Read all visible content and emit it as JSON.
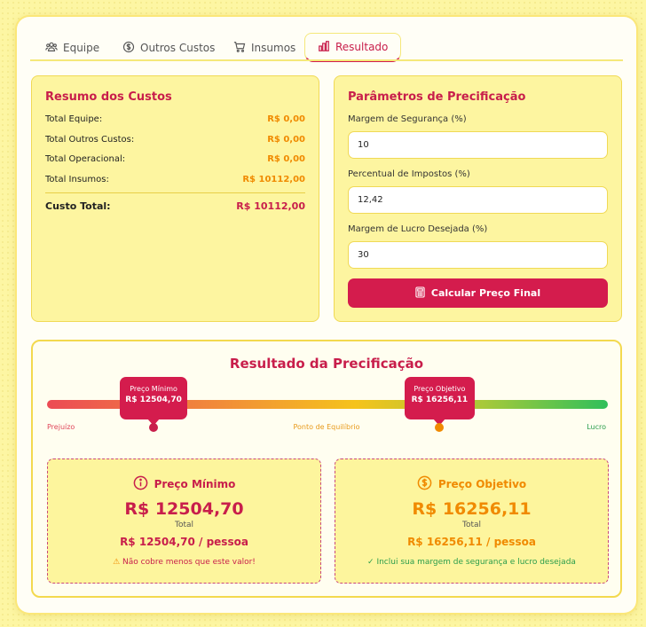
{
  "tabs": [
    {
      "label": "Equipe",
      "icon": "users-icon"
    },
    {
      "label": "Outros Custos",
      "icon": "dollar-circle-icon"
    },
    {
      "label": "Insumos",
      "icon": "cart-icon"
    },
    {
      "label": "Resultado",
      "icon": "bar-chart-icon",
      "active": true
    }
  ],
  "summary": {
    "title": "Resumo dos Custos",
    "rows": [
      {
        "label": "Total Equipe:",
        "value": "R$ 0,00"
      },
      {
        "label": "Total Outros Custos:",
        "value": "R$ 0,00"
      },
      {
        "label": "Total Operacional:",
        "value": "R$ 0,00"
      },
      {
        "label": "Total Insumos:",
        "value": "R$ 10112,00"
      }
    ],
    "total_label": "Custo Total:",
    "total_value": "R$ 10112,00"
  },
  "params": {
    "title": "Parâmetros de Precificação",
    "safety_label": "Margem de Segurança (%)",
    "safety_value": "10",
    "tax_label": "Percentual de Impostos (%)",
    "tax_value": "12,42",
    "profit_label": "Margem de Lucro Desejada (%)",
    "profit_value": "30",
    "button_label": "Calcular Preço Final"
  },
  "result": {
    "title": "Resultado da Precificação",
    "scale": {
      "left": "Prejuízo",
      "middle": "Ponto de Equilíbrio",
      "right": "Lucro"
    },
    "bubble_min": {
      "label": "Preço Mínimo",
      "price": "R$ 12504,70",
      "position": 0.19
    },
    "bubble_target": {
      "label": "Preço Objetivo",
      "price": "R$ 16256,11",
      "position": 0.7
    },
    "min_card": {
      "title": "Preço Mínimo",
      "value": "R$ 12504,70",
      "caption": "Total",
      "per_person": "R$ 12504,70 / pessoa",
      "note": "Não cobre menos que este valor!",
      "note_icon": "warning-icon"
    },
    "target_card": {
      "title": "Preço Objetivo",
      "value": "R$ 16256,11",
      "caption": "Total",
      "per_person": "R$ 16256,11 / pessoa",
      "note": "✓ Inclui sua margem de segurança e lucro desejada"
    }
  },
  "colors": {
    "accent": "#d41c4d",
    "orange": "#f08a00",
    "green": "#2a9d4b",
    "panel": "#fdf5a0"
  }
}
